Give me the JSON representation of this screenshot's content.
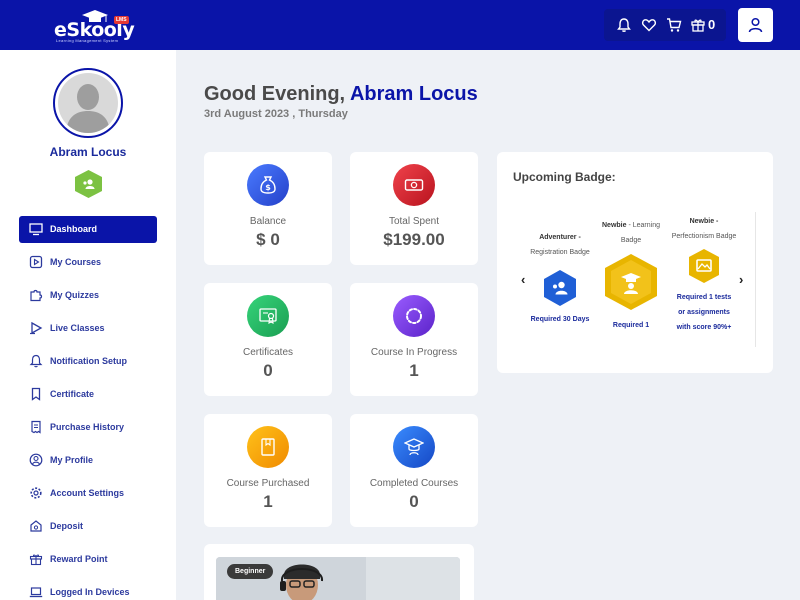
{
  "header": {
    "logo_text": "eSkooly",
    "logo_tag": "LMS",
    "logo_subtext": "Learning Management System",
    "cart_count": "0",
    "icons": [
      "bell-icon",
      "heart-icon",
      "cart-icon",
      "gift-icon",
      "user-icon"
    ]
  },
  "profile": {
    "name": "Abram Locus"
  },
  "sidebar": {
    "items": [
      {
        "label": "Dashboard",
        "icon": "monitor-icon",
        "active": true
      },
      {
        "label": "My Courses",
        "icon": "play-icon"
      },
      {
        "label": "My Quizzes",
        "icon": "puzzle-icon"
      },
      {
        "label": "Live Classes",
        "icon": "live-icon"
      },
      {
        "label": "Notification Setup",
        "icon": "bell-icon"
      },
      {
        "label": "Certificate",
        "icon": "bookmark-icon"
      },
      {
        "label": "Purchase History",
        "icon": "receipt-icon"
      },
      {
        "label": "My Profile",
        "icon": "profile-icon"
      },
      {
        "label": "Account Settings",
        "icon": "gear-icon"
      },
      {
        "label": "Deposit",
        "icon": "deposit-icon"
      },
      {
        "label": "Reward Point",
        "icon": "gift-icon"
      },
      {
        "label": "Logged In Devices",
        "icon": "laptop-icon"
      }
    ]
  },
  "greeting": {
    "prefix": "Good Evening,",
    "name": "Abram Locus",
    "date": "3rd August 2023 , Thursday"
  },
  "stats": [
    {
      "label": "Balance",
      "value": "$ 0",
      "color": "#2f55d4"
    },
    {
      "label": "Total Spent",
      "value": "$199.00",
      "color": "#e1252f"
    },
    {
      "label": "Certificates",
      "value": "0",
      "color": "#2bbf6a"
    },
    {
      "label": "Course In Progress",
      "value": "1",
      "color": "#7b3fe4"
    },
    {
      "label": "Course Purchased",
      "value": "1",
      "color": "#f5a300"
    },
    {
      "label": "Completed Courses",
      "value": "0",
      "color": "#1f6fe0"
    }
  ],
  "upcoming_badge": {
    "title": "Upcoming Badge:",
    "badges": [
      {
        "name": "Adventurer",
        "type": "Registration Badge",
        "requirement": "Required 30 Days"
      },
      {
        "name": "Newbie",
        "type": "Learning Badge",
        "requirement": "Required 1"
      },
      {
        "name": "Newbie",
        "type": "Perfectionism Badge",
        "requirement_lines": [
          "Required 1 tests",
          "or assignments",
          "with score 90%+"
        ]
      }
    ]
  },
  "course_card": {
    "level": "Beginner"
  }
}
